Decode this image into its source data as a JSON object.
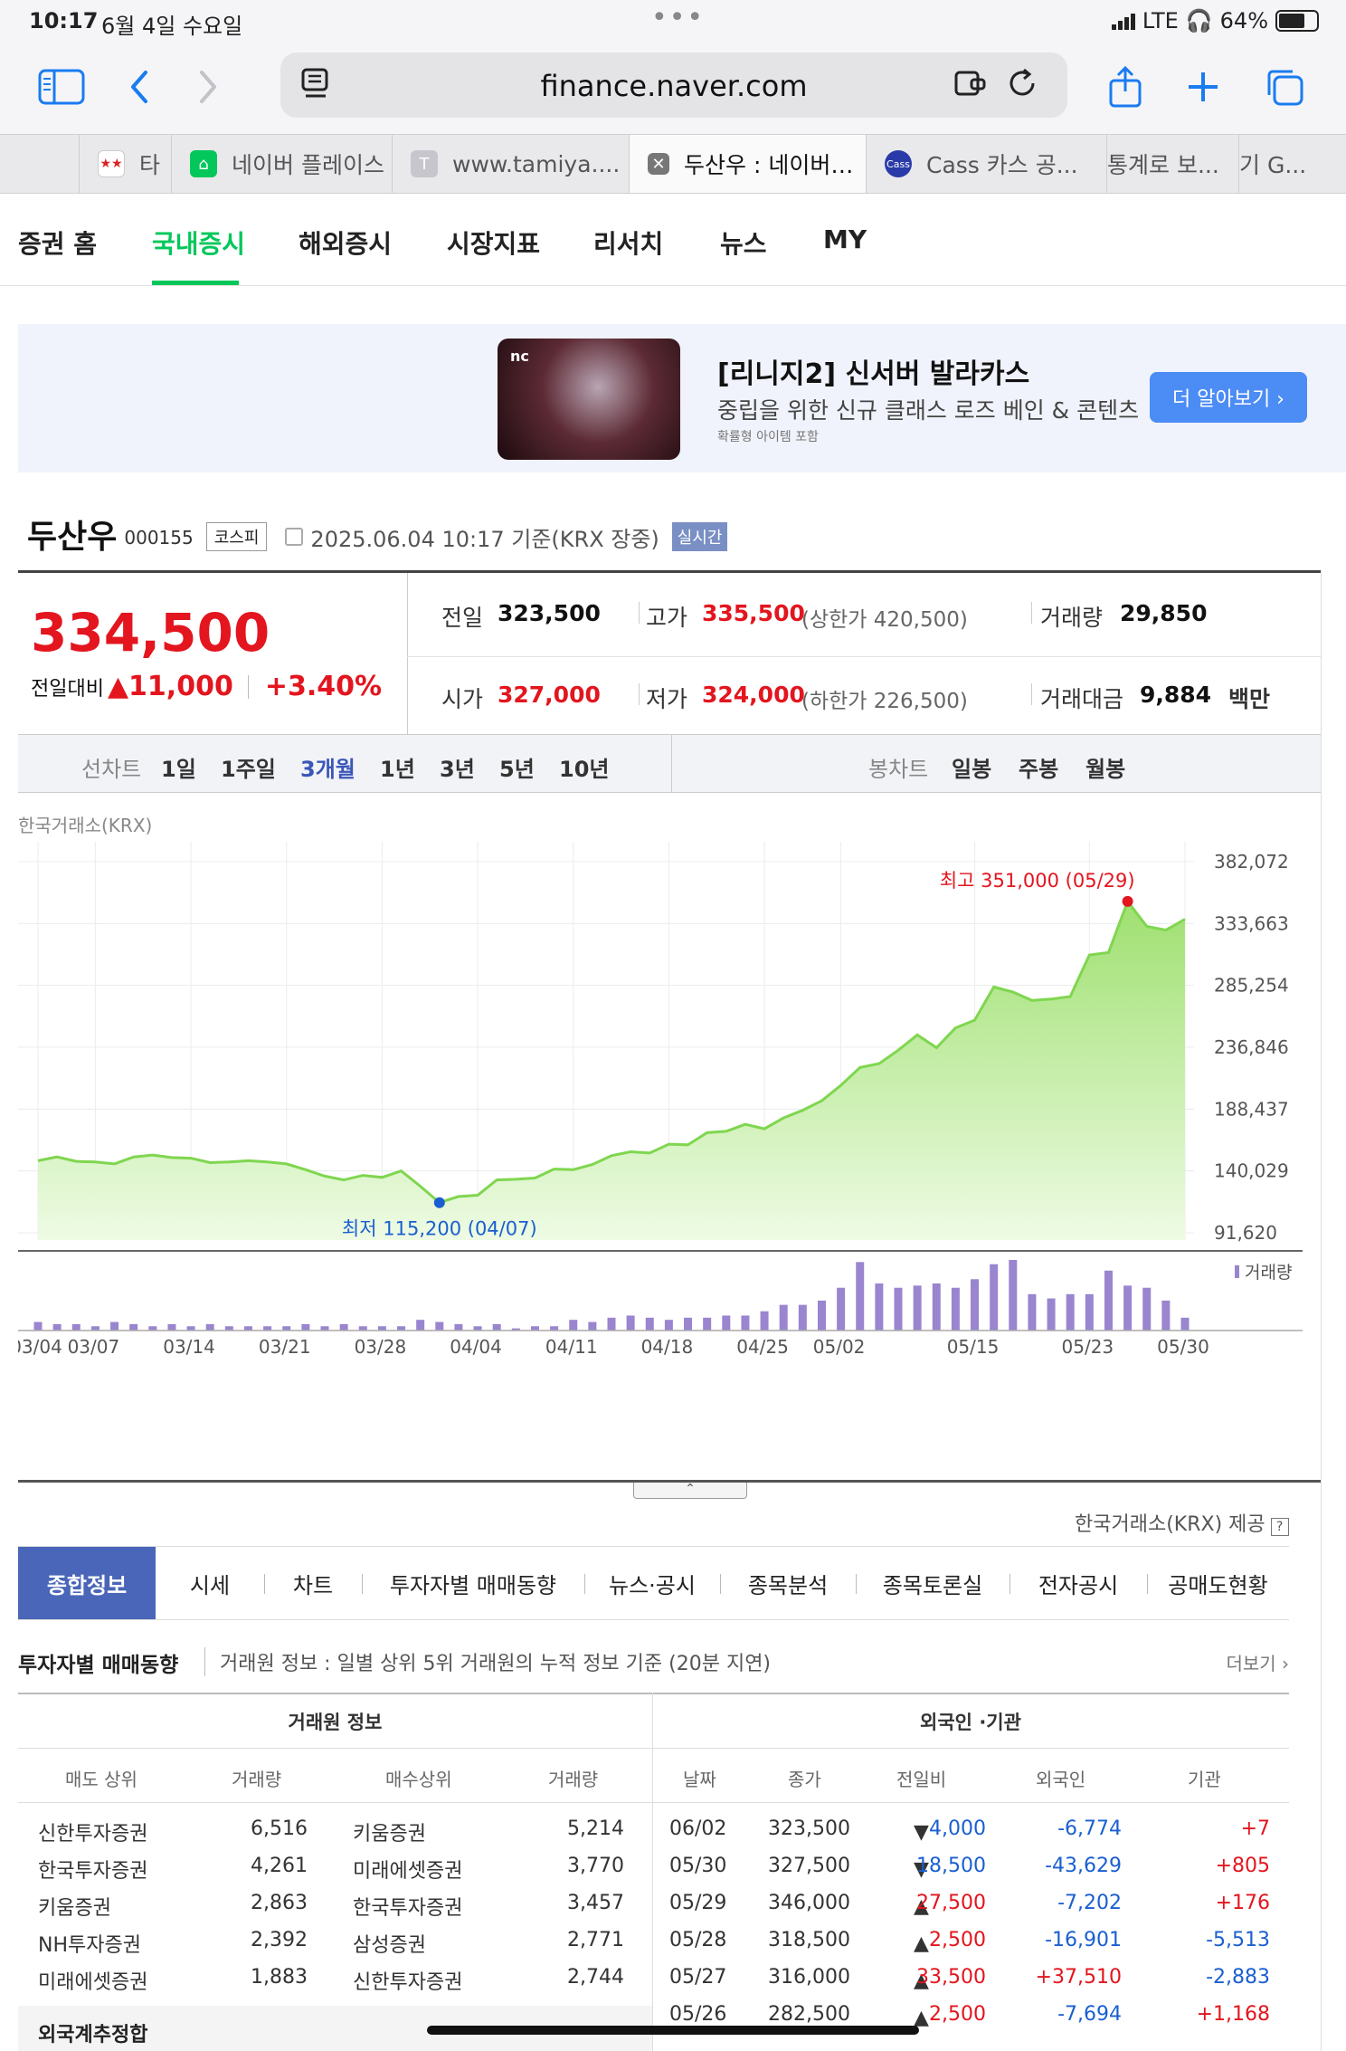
{
  "status": {
    "time": "10:17",
    "date": "6월 4일 수요일",
    "network": "LTE",
    "battery": "64%",
    "battery_level": 0.64
  },
  "browser": {
    "url": "finance.naver.com",
    "tabs": [
      {
        "label": "타",
        "active": false
      },
      {
        "label": "네이버 플레이스",
        "active": false
      },
      {
        "label": "www.tamiya....",
        "active": false
      },
      {
        "label": "두산우 : 네이버…",
        "active": true
      },
      {
        "label": "Cass 카스 공...",
        "active": false
      },
      {
        "label": "통계로 보...",
        "active": false
      },
      {
        "label": "기 G...",
        "active": false
      }
    ]
  },
  "sitenav": {
    "items": [
      "증권 홈",
      "국내증시",
      "해외증시",
      "시장지표",
      "리서치",
      "뉴스",
      "MY"
    ],
    "active": "국내증시"
  },
  "ad": {
    "badge": "nc",
    "title": "[리니지2] 신서버 발라카스",
    "desc": "중립을 위한 신규 클래스 로즈 베인 & 콘텐츠",
    "small": "확률형 아이템 포함",
    "button": "더 알아보기 ›"
  },
  "stock": {
    "name": "두산우",
    "code": "000155",
    "market": "코스피",
    "timestamp": "2025.06.04 10:17 기준(KRX 장중)",
    "live_badge": "실시간",
    "price": "334,500",
    "change_label": "전일대비",
    "change": "11,000",
    "change_pct": "+3.40%",
    "stats": {
      "prev_label": "전일",
      "prev": "323,500",
      "high_label": "고가",
      "high": "335,500",
      "upper_limit": "(상한가 420,500)",
      "volume_label": "거래량",
      "volume": "29,850",
      "open_label": "시가",
      "open": "327,000",
      "low_label": "저가",
      "low": "324,000",
      "lower_limit": "(하한가 226,500)",
      "amount_label": "거래대금",
      "amount": "9,884",
      "amount_unit": "백만"
    }
  },
  "charttabs": {
    "line_label": "선차트",
    "line_periods": [
      "1일",
      "1주일",
      "3개월",
      "1년",
      "3년",
      "5년",
      "10년"
    ],
    "active": "3개월",
    "candle_label": "봉차트",
    "candle_periods": [
      "일봉",
      "주봉",
      "월봉"
    ]
  },
  "chart_source": "한국거래소(KRX)",
  "chart_data": {
    "type": "area",
    "title": "",
    "xlabel": "",
    "ylabel": "",
    "y_ticks": [
      "382,072",
      "333,663",
      "285,254",
      "236,846",
      "188,437",
      "140,029",
      "91,620"
    ],
    "ylim": [
      91620,
      382072
    ],
    "x_ticks": [
      "03/04",
      "03/07",
      "03/14",
      "03/21",
      "03/28",
      "04/04",
      "04/11",
      "04/18",
      "04/25",
      "05/02",
      "05/15",
      "05/23",
      "05/30"
    ],
    "high_annotation": "최고 351,000 (05/29)",
    "low_annotation": "최저 115,200 (04/07)",
    "series": [
      {
        "values": [
          148000,
          151000,
          147500,
          147000,
          145500,
          151000,
          152500,
          150500,
          150000,
          146500,
          147000,
          148000,
          147000,
          145500,
          141000,
          136000,
          133000,
          136500,
          135000,
          140000,
          128000,
          115200,
          120000,
          121000,
          133000,
          133500,
          134500,
          141500,
          141000,
          145000,
          152000,
          155000,
          154000,
          161000,
          160500,
          170000,
          171000,
          176500,
          173000,
          181500,
          187500,
          195000,
          207000,
          221000,
          224000,
          234500,
          246500,
          236500,
          252000,
          258000,
          284000,
          280000,
          273500,
          274500,
          276500,
          309000,
          311000,
          351000,
          331500,
          328500,
          337000
        ]
      },
      {
        "name": "거래량",
        "values": [
          4,
          3,
          3,
          2,
          4,
          3,
          2,
          3,
          2,
          3,
          2,
          2,
          2,
          2,
          3,
          2,
          3,
          2,
          2,
          2,
          5,
          4,
          3,
          2,
          3,
          1,
          2,
          2,
          5,
          4,
          6,
          7,
          6,
          5,
          6,
          6,
          7,
          7,
          9,
          12,
          12,
          14,
          20,
          32,
          22,
          20,
          21,
          22,
          20,
          24,
          31,
          33,
          17,
          15,
          17,
          17,
          28,
          21,
          20,
          14,
          6
        ]
      }
    ]
  },
  "provided_by": "한국거래소(KRX) 제공",
  "infotabs": {
    "items": [
      "종합정보",
      "시세",
      "차트",
      "투자자별 매매동향",
      "뉴스·공시",
      "종목분석",
      "종목토론실",
      "전자공시",
      "공매도현황"
    ],
    "active": "종합정보"
  },
  "section": {
    "title": "투자자별 매매동향",
    "desc": "거래원 정보 : 일별 상위 5위 거래원의 누적 정보 기준 (20분 지연)",
    "more": "더보기"
  },
  "broker_table": {
    "group_header": "거래원 정보",
    "headers": [
      "매도 상위",
      "거래량",
      "매수상위",
      "거래량"
    ],
    "rows": [
      [
        "신한투자증권",
        "6,516",
        "키움증권",
        "5,214"
      ],
      [
        "한국투자증권",
        "4,261",
        "미래에셋증권",
        "3,770"
      ],
      [
        "키움증권",
        "2,863",
        "한국투자증권",
        "3,457"
      ],
      [
        "NH투자증권",
        "2,392",
        "삼성증권",
        "2,771"
      ],
      [
        "미래에셋증권",
        "1,883",
        "신한투자증권",
        "2,744"
      ]
    ],
    "summary": "외국계추정합"
  },
  "foreign_table": {
    "group_header": "외국인 ·기관",
    "headers": [
      "날짜",
      "종가",
      "전일비",
      "외국인",
      "기관"
    ],
    "rows": [
      {
        "date": "06/02",
        "close": "323,500",
        "dir": "down",
        "change": "4,000",
        "foreign": "-6,774",
        "inst": "+7"
      },
      {
        "date": "05/30",
        "close": "327,500",
        "dir": "down",
        "change": "18,500",
        "foreign": "-43,629",
        "inst": "+805"
      },
      {
        "date": "05/29",
        "close": "346,000",
        "dir": "up",
        "change": "27,500",
        "foreign": "-7,202",
        "inst": "+176"
      },
      {
        "date": "05/28",
        "close": "318,500",
        "dir": "up",
        "change": "2,500",
        "foreign": "-16,901",
        "inst": "-5,513"
      },
      {
        "date": "05/27",
        "close": "316,000",
        "dir": "up",
        "change": "33,500",
        "foreign": "+37,510",
        "inst": "-2,883"
      },
      {
        "date": "05/26",
        "close": "282,500",
        "dir": "up",
        "change": "2,500",
        "foreign": "-7,694",
        "inst": "+1,168"
      }
    ]
  }
}
